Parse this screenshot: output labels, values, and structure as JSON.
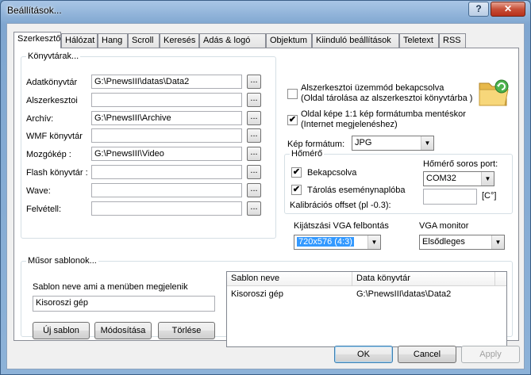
{
  "window": {
    "title": "Beállítások...",
    "help_label": "?",
    "close_label": "✕"
  },
  "tabs": [
    {
      "label": "Szerkesztő",
      "active": true
    },
    {
      "label": "Hálózat"
    },
    {
      "label": "Hang"
    },
    {
      "label": "Scroll"
    },
    {
      "label": "Keresés"
    },
    {
      "label": "Adás & logó"
    },
    {
      "label": "Objektum"
    },
    {
      "label": "Kiinduló beállítások"
    },
    {
      "label": "Teletext"
    },
    {
      "label": "RSS"
    }
  ],
  "directories": {
    "legend": "Könyvtárak...",
    "rows": [
      {
        "label": "Adatkönyvtár",
        "value": "G:\\PnewsIII\\datas\\Data2"
      },
      {
        "label": "Alszerkesztoi",
        "value": ""
      },
      {
        "label": "Archív:",
        "value": "G:\\PnewsIII\\Archive"
      },
      {
        "label": "WMF könyvtár",
        "value": ""
      },
      {
        "label": "Mozgókép :",
        "value": "G:\\PnewsIII\\Video"
      },
      {
        "label": "Flash könyvtár :",
        "value": ""
      },
      {
        "label": "Wave:",
        "value": ""
      },
      {
        "label": "Felvétell:",
        "value": ""
      }
    ],
    "browse_label": "..."
  },
  "options": {
    "subeditor_mode": {
      "line1": "Alszerkesztoi üzemmód bekapcsolva",
      "line2": "(Oldal tárolása az alszerkesztoi könyvtárba )",
      "checked": false
    },
    "save_image": {
      "line1": "Oldal képe 1:1 kép formátumba  mentéskor",
      "line2": "(Internet megjelenéshez)",
      "checked": true
    },
    "image_format_label": "Kép formátum:",
    "image_format_value": "JPG"
  },
  "thermometer": {
    "legend": "Hőmérő",
    "enabled_label": "Bekapcsolva",
    "enabled_checked": true,
    "log_label": "Tárolás eseménynaplóba",
    "log_checked": true,
    "calib_label": "Kalibrációs offset (pl -0.3):",
    "calib_value": "",
    "port_label": "Hőmérő soros port:",
    "port_value": "COM32",
    "unit_label": "[C°]"
  },
  "display": {
    "vga_res_label": "Kijátszási VGA felbontás",
    "vga_res_value": "720x576 (4:3)",
    "vga_monitor_label": "VGA monitor",
    "vga_monitor_value": "Elsődleges"
  },
  "templates": {
    "legend": "Műsor sablonok...",
    "name_label": "Sablon neve ami a menüben megjelenik",
    "name_value": "Kisoroszi gép",
    "new_button": "Új sablon",
    "modify_button": "Módosítása",
    "delete_button": "Törlése",
    "columns": [
      "Sablon neve",
      "Data könyvtár"
    ],
    "rows": [
      {
        "name": "Kisoroszi gép",
        "dir": "G:\\PnewsIII\\datas\\Data2"
      }
    ]
  },
  "footer": {
    "ok": "OK",
    "cancel": "Cancel",
    "apply": "Apply"
  }
}
